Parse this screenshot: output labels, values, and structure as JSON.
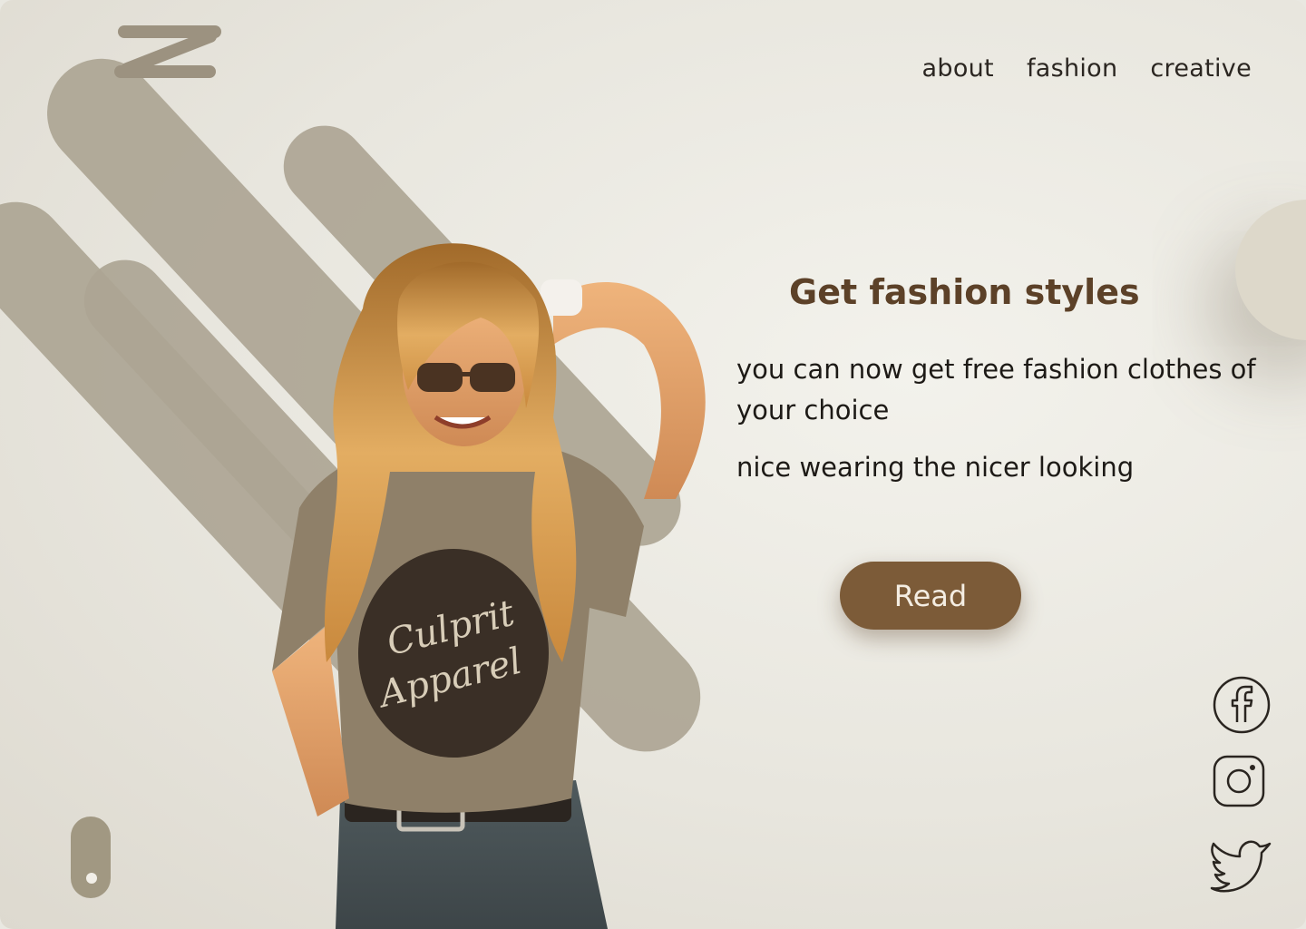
{
  "nav": {
    "items": [
      {
        "label": "about"
      },
      {
        "label": "fashion"
      },
      {
        "label": "creative"
      }
    ]
  },
  "hero": {
    "title": "Get fashion styles",
    "line1": "you can now get free fashion clothes of your choice",
    "line2": "nice wearing the nicer looking",
    "button": "Read",
    "shirt_print_line1": "Culprit",
    "shirt_print_line2": "Apparel"
  },
  "social": {
    "icons": [
      "facebook-icon",
      "instagram-icon",
      "twitter-icon"
    ]
  },
  "colors": {
    "accent": "#7c5b38",
    "title": "#5c4128",
    "stripe": "#aca594",
    "background": "#e9e8e1"
  }
}
